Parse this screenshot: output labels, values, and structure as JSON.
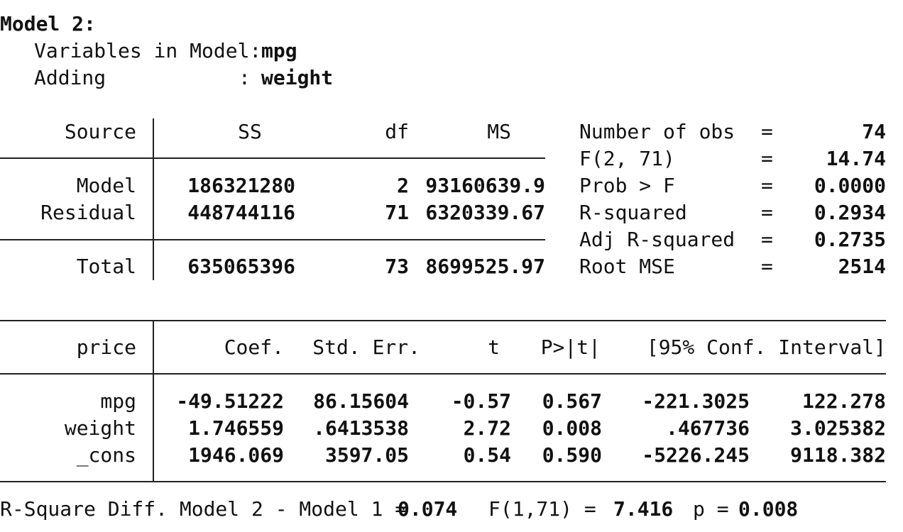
{
  "header": {
    "model_title": "Model 2:",
    "variables_label": "Variables in Model:",
    "variables_value": "mpg",
    "adding_label": "Adding",
    "adding_colon": ":",
    "adding_value": "weight"
  },
  "anova": {
    "headers": [
      "Source",
      "SS",
      "df",
      "MS"
    ],
    "rows": [
      {
        "source": "Model",
        "ss": "186321280",
        "df": "2",
        "ms": "93160639.9"
      },
      {
        "source": "Residual",
        "ss": "448744116",
        "df": "71",
        "ms": "6320339.67"
      },
      {
        "source": "Total",
        "ss": "635065396",
        "df": "73",
        "ms": "8699525.97"
      }
    ]
  },
  "fit_stats": [
    {
      "label": "Number of obs",
      "eq": "=",
      "value": "74"
    },
    {
      "label": "F(2, 71)",
      "eq": "=",
      "value": "14.74"
    },
    {
      "label": "Prob > F",
      "eq": "=",
      "value": "0.0000"
    },
    {
      "label": "R-squared",
      "eq": "=",
      "value": "0.2934"
    },
    {
      "label": "Adj R-squared",
      "eq": "=",
      "value": "0.2735"
    },
    {
      "label": "Root MSE",
      "eq": "=",
      "value": "2514"
    }
  ],
  "coef_table": {
    "headers": [
      "price",
      "Coef.",
      "Std. Err.",
      "t",
      "P>|t|",
      "[95% Conf. Interval]"
    ],
    "rows": [
      {
        "var": "mpg",
        "coef": "-49.51222",
        "se": "86.15604",
        "t": "-0.57",
        "p": "0.567",
        "lo": "-221.3025",
        "hi": "122.278"
      },
      {
        "var": "weight",
        "coef": "1.746559",
        "se": ".6413538",
        "t": "2.72",
        "p": "0.008",
        "lo": ".467736",
        "hi": "3.025382"
      },
      {
        "var": "_cons",
        "coef": "1946.069",
        "se": "3597.05",
        "t": "0.54",
        "p": "0.590",
        "lo": "-5226.245",
        "hi": "9118.382"
      }
    ]
  },
  "footer": {
    "rsq_label": "R-Square Diff. Model 2 - Model 1 =",
    "rsq_value": "0.074",
    "f_label": "F(1,71) =",
    "f_value": "7.416",
    "p_label": "p =",
    "p_value": "0.008"
  }
}
